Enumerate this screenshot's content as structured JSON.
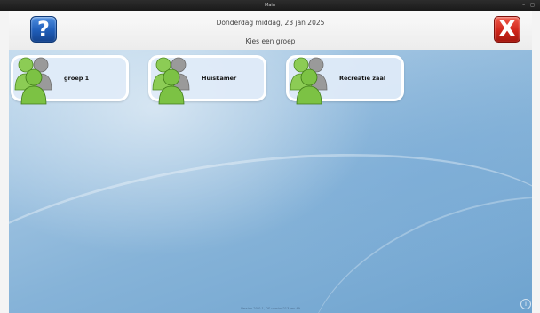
{
  "window": {
    "title": "Main",
    "controls": "– ◻"
  },
  "header": {
    "help_glyph": "?",
    "close_glyph": "X",
    "date": "Donderdag middag, 23 jan 2025",
    "subtitle": "Kies een groep"
  },
  "groups": [
    {
      "label": "groep 1"
    },
    {
      "label": "Huiskamer"
    },
    {
      "label": "Recreatie zaal"
    }
  ],
  "footer": {
    "version": "Version 20.0.1, OS version213 rev 49"
  },
  "colors": {
    "help_blue": "#1f5db8",
    "close_red": "#d0261b",
    "person_green": "#7cc244",
    "person_gray": "#9a9a9a"
  }
}
